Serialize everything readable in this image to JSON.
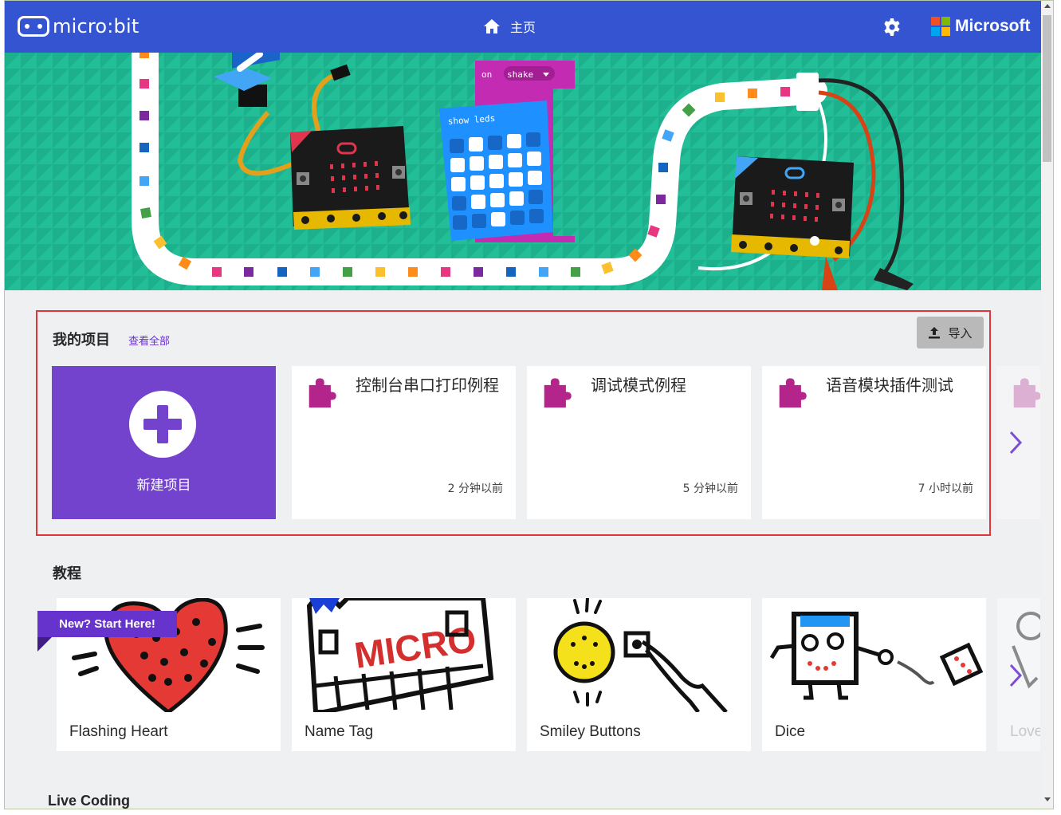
{
  "header": {
    "logo_text": "micro:bit",
    "home_label": "主页",
    "brand": "Microsoft",
    "colors": {
      "bar": "#3454d1",
      "ms_red": "#f25022",
      "ms_green": "#7fba00",
      "ms_blue": "#00a4ef",
      "ms_yellow": "#ffb900"
    }
  },
  "hero": {
    "block_on": "on",
    "block_shake": "shake",
    "block_show_leds": "show leds"
  },
  "my_projects": {
    "title": "我的项目",
    "view_all": "查看全部",
    "import_label": "导入",
    "new_project_label": "新建项目",
    "projects": [
      {
        "title": "控制台串口打印例程",
        "time": "2 分钟以前"
      },
      {
        "title": "调试模式例程",
        "time": "5 分钟以前"
      },
      {
        "title": "语音模块插件测试",
        "time": "7 小时以前"
      }
    ]
  },
  "tutorials": {
    "title": "教程",
    "new_badge": "New? Start Here!",
    "items": [
      {
        "label": "Flashing Heart"
      },
      {
        "label": "Name Tag"
      },
      {
        "label": "Smiley Buttons"
      },
      {
        "label": "Dice"
      },
      {
        "label": "Love"
      }
    ]
  },
  "next_section": {
    "title": "Live Coding"
  }
}
